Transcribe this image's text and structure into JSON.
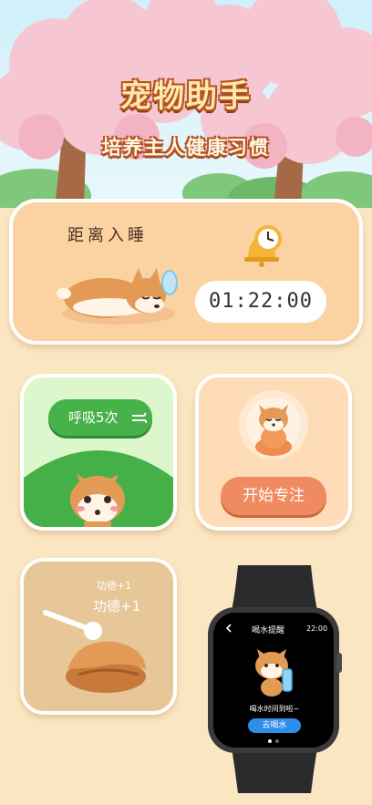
{
  "header": {
    "title": "宠物助手",
    "subtitle": "培养主人健康习惯"
  },
  "sleep_card": {
    "label": "距离入睡",
    "countdown": "01:22:00",
    "icon": "alarm-clock-icon"
  },
  "breath_card": {
    "button_label": "呼吸5次",
    "icon": "wind-icon"
  },
  "focus_card": {
    "button_label": "开始专注"
  },
  "merit_card": {
    "small_text": "功德+1",
    "big_text": "功德+1"
  },
  "watch": {
    "title": "喝水提醒",
    "time": "22:00",
    "back_icon": "back-arrow-icon",
    "message": "喝水时间到啦~",
    "button_label": "去喝水"
  },
  "colors": {
    "title_fill": "#FFE7AE",
    "title_outline": "#B5531F",
    "sleep_card": "#FBD3A3",
    "breath_button": "#47B14A",
    "focus_button": "#F08A60",
    "watch_button": "#2E8FEA"
  }
}
